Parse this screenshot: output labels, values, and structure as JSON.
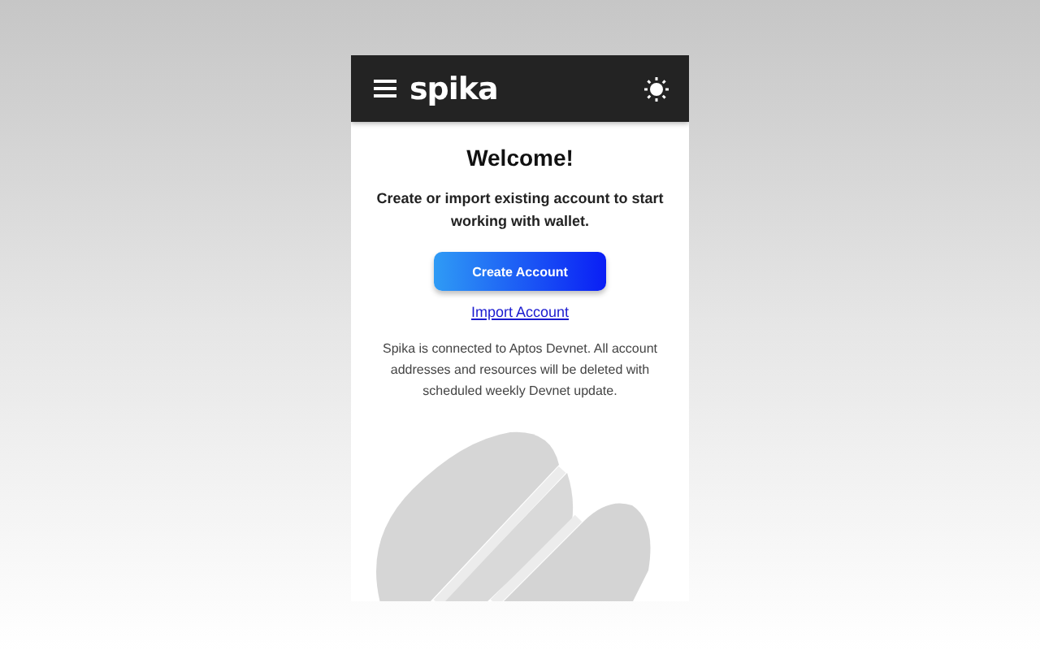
{
  "header": {
    "logo": "spika"
  },
  "welcome": {
    "title": "Welcome!",
    "subtitle": "Create or import existing account to start working with wallet."
  },
  "buttons": {
    "create": "Create Account",
    "import": "Import Account"
  },
  "notice": "Spika is connected to Aptos Devnet. All account addresses and resources will be deleted with scheduled weekly Devnet update."
}
